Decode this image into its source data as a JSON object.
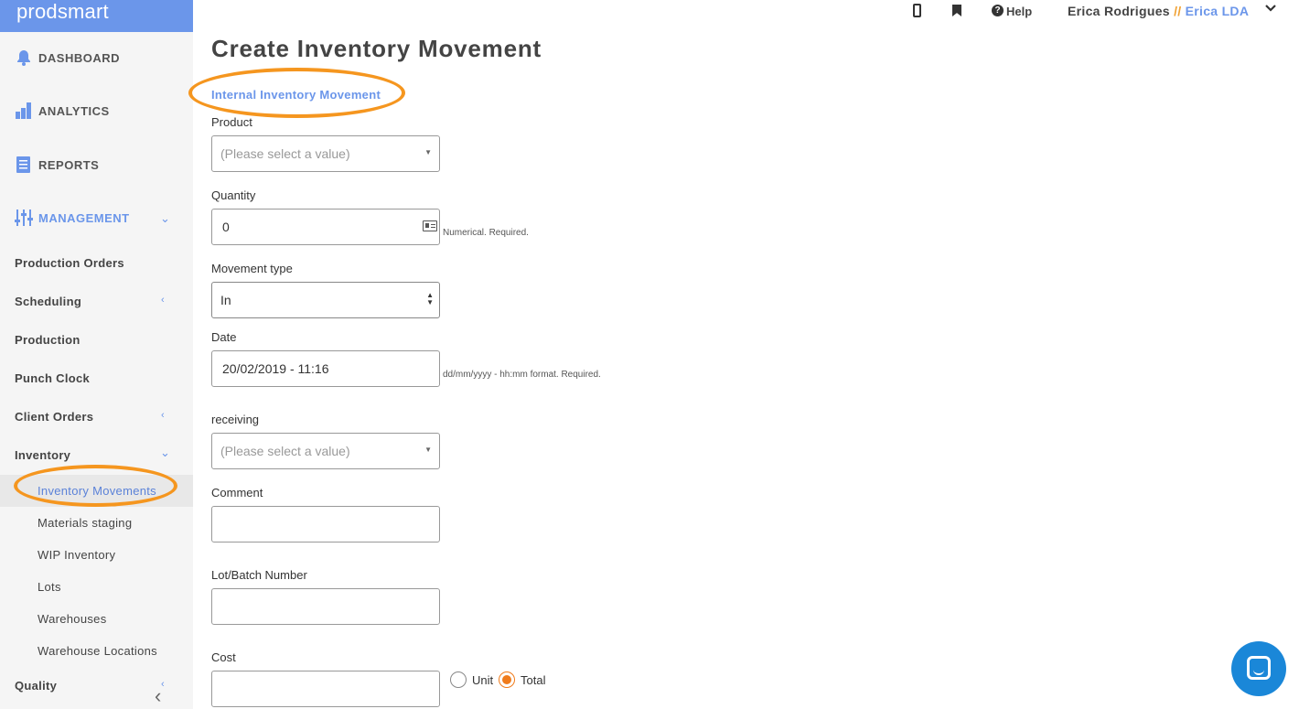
{
  "brand": "prodsmart",
  "sidebar": {
    "main": [
      {
        "label": "DASHBOARD",
        "icon": "bell-icon"
      },
      {
        "label": "ANALYTICS",
        "icon": "bar-chart-icon"
      },
      {
        "label": "REPORTS",
        "icon": "document-icon"
      },
      {
        "label": "MANAGEMENT",
        "icon": "sliders-icon"
      }
    ],
    "items": [
      {
        "label": "Production Orders"
      },
      {
        "label": "Scheduling"
      },
      {
        "label": "Production"
      },
      {
        "label": "Punch Clock"
      },
      {
        "label": "Client Orders"
      },
      {
        "label": "Inventory"
      }
    ],
    "sub_items": [
      {
        "label": "Inventory Movements"
      },
      {
        "label": "Materials staging"
      },
      {
        "label": "WIP Inventory"
      },
      {
        "label": "Lots"
      },
      {
        "label": "Warehouses"
      },
      {
        "label": "Warehouse Locations"
      }
    ],
    "bottom_item": "Quality",
    "accent": "#6b96ea"
  },
  "header": {
    "help": "Help",
    "user": "Erica Rodrigues",
    "separator": " // ",
    "company": "Erica LDA"
  },
  "page": {
    "title": "Create Inventory Movement",
    "subtitle": "Internal Inventory Movement"
  },
  "form": {
    "product": {
      "label": "Product",
      "placeholder": "(Please select a value)"
    },
    "quantity": {
      "label": "Quantity",
      "value": "0",
      "hint": "Numerical. Required."
    },
    "movement_type": {
      "label": "Movement type",
      "value": "In"
    },
    "date": {
      "label": "Date",
      "value": "20/02/2019 - 11:16",
      "hint": "dd/mm/yyyy - hh:mm format. Required."
    },
    "receiving": {
      "label": "receiving",
      "placeholder": "(Please select a value)"
    },
    "comment": {
      "label": "Comment",
      "value": ""
    },
    "lot": {
      "label": "Lot/Batch Number",
      "value": ""
    },
    "cost": {
      "label": "Cost",
      "value": "",
      "unit_label": "Unit",
      "total_label": "Total",
      "selected": "Total"
    }
  },
  "colors": {
    "highlight_ring": "#f5961f",
    "radio_checked": "#f07b1b",
    "chat_button": "#1a87d8"
  }
}
